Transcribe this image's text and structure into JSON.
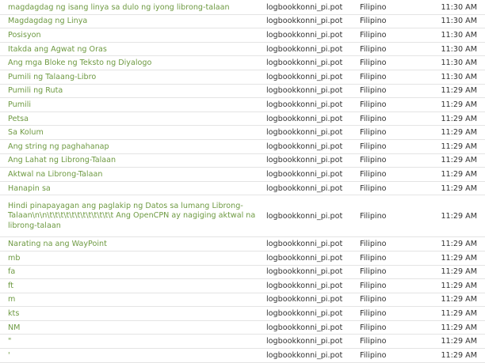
{
  "rows": [
    {
      "source": "magdagdag ng isang linya sa dulo ng iyong librong-talaan",
      "file": "logbookkonni_pi.pot",
      "language": "Filipino",
      "time": "11:30 AM"
    },
    {
      "source": "Magdagdag ng Linya",
      "file": "logbookkonni_pi.pot",
      "language": "Filipino",
      "time": "11:30 AM"
    },
    {
      "source": "Posisyon",
      "file": "logbookkonni_pi.pot",
      "language": "Filipino",
      "time": "11:30 AM"
    },
    {
      "source": "Itakda ang Agwat ng Oras",
      "file": "logbookkonni_pi.pot",
      "language": "Filipino",
      "time": "11:30 AM"
    },
    {
      "source": "Ang mga Bloke ng Teksto ng Diyalogo",
      "file": "logbookkonni_pi.pot",
      "language": "Filipino",
      "time": "11:30 AM"
    },
    {
      "source": "Pumili ng Talaang-Libro",
      "file": "logbookkonni_pi.pot",
      "language": "Filipino",
      "time": "11:30 AM"
    },
    {
      "source": "Pumili ng Ruta",
      "file": "logbookkonni_pi.pot",
      "language": "Filipino",
      "time": "11:29 AM"
    },
    {
      "source": "Pumili",
      "file": "logbookkonni_pi.pot",
      "language": "Filipino",
      "time": "11:29 AM"
    },
    {
      "source": "Petsa",
      "file": "logbookkonni_pi.pot",
      "language": "Filipino",
      "time": "11:29 AM"
    },
    {
      "source": "Sa Kolum",
      "file": "logbookkonni_pi.pot",
      "language": "Filipino",
      "time": "11:29 AM"
    },
    {
      "source": "Ang string ng paghahanap",
      "file": "logbookkonni_pi.pot",
      "language": "Filipino",
      "time": "11:29 AM"
    },
    {
      "source": "Ang Lahat ng Librong-Talaan",
      "file": "logbookkonni_pi.pot",
      "language": "Filipino",
      "time": "11:29 AM"
    },
    {
      "source": "Aktwal na Librong-Talaan",
      "file": "logbookkonni_pi.pot",
      "language": "Filipino",
      "time": "11:29 AM"
    },
    {
      "source": "Hanapin sa",
      "file": "logbookkonni_pi.pot",
      "language": "Filipino",
      "time": "11:29 AM"
    },
    {
      "source": "Hindi pinapayagan ang paglakip ng Datos sa lumang Librong-Talaan\\n\\n\\t\\t\\t\\t\\t\\t\\t\\t\\t\\t\\t\\t Ang OpenCPN ay nagiging aktwal na librong-talaan",
      "file": "logbookkonni_pi.pot",
      "language": "Filipino",
      "time": "11:29 AM",
      "tall": true
    },
    {
      "source": "Narating na ang WayPoint",
      "file": "logbookkonni_pi.pot",
      "language": "Filipino",
      "time": "11:29 AM"
    },
    {
      "source": "mb",
      "file": "logbookkonni_pi.pot",
      "language": "Filipino",
      "time": "11:29 AM"
    },
    {
      "source": "fa",
      "file": "logbookkonni_pi.pot",
      "language": "Filipino",
      "time": "11:29 AM"
    },
    {
      "source": "ft",
      "file": "logbookkonni_pi.pot",
      "language": "Filipino",
      "time": "11:29 AM"
    },
    {
      "source": "m",
      "file": "logbookkonni_pi.pot",
      "language": "Filipino",
      "time": "11:29 AM"
    },
    {
      "source": "kts",
      "file": "logbookkonni_pi.pot",
      "language": "Filipino",
      "time": "11:29 AM"
    },
    {
      "source": "NM",
      "file": "logbookkonni_pi.pot",
      "language": "Filipino",
      "time": "11:29 AM"
    },
    {
      "source": "\"",
      "file": "logbookkonni_pi.pot",
      "language": "Filipino",
      "time": "11:29 AM"
    },
    {
      "source": "'",
      "file": "logbookkonni_pi.pot",
      "language": "Filipino",
      "time": "11:29 AM"
    }
  ],
  "colors": {
    "source_link": "#6e9a42",
    "text": "#333333",
    "divider": "#e4e4e4"
  }
}
